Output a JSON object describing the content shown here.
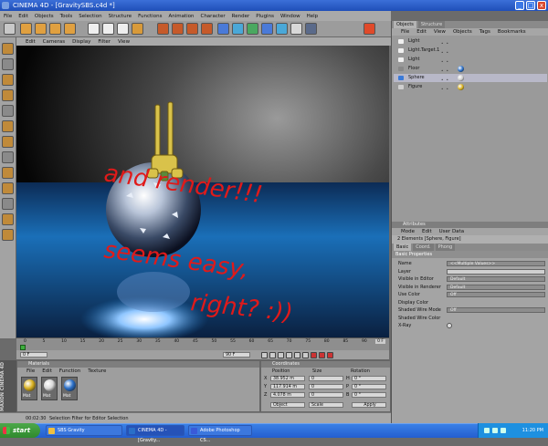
{
  "window": {
    "title": "CINEMA 4D - [GravitySBS.c4d *]",
    "buttons": [
      "_",
      "□",
      "x"
    ]
  },
  "menubar": [
    "File",
    "Edit",
    "Objects",
    "Tools",
    "Selection",
    "Structure",
    "Functions",
    "Animation",
    "Character",
    "Render",
    "Plugins",
    "Window",
    "Help"
  ],
  "viewport_menu": [
    "Edit",
    "Cameras",
    "Display",
    "Filter",
    "View"
  ],
  "annotation": [
    "and render!!!",
    "seems easy,",
    "right? :))"
  ],
  "timeline": {
    "ticks": [
      "0",
      "5",
      "10",
      "15",
      "20",
      "25",
      "30",
      "35",
      "40",
      "45",
      "50",
      "55",
      "60",
      "65",
      "70",
      "75",
      "80",
      "85",
      "90"
    ],
    "end_label": "0 F",
    "start_field": "0 F",
    "end_field": "90 F"
  },
  "materials": {
    "title": "Materials",
    "menu": [
      "File",
      "Edit",
      "Function",
      "Texture"
    ],
    "items": [
      "Mat",
      "Mat",
      "Mat"
    ]
  },
  "coordinates": {
    "title": "Coordinates",
    "headers": [
      "Position",
      "Size",
      "Rotation"
    ],
    "rows": [
      {
        "axis": "X",
        "pos": "38.952 m",
        "size": "0",
        "rot_label": "H",
        "rot": "0 °"
      },
      {
        "axis": "Y",
        "pos": "117.914 m",
        "size": "0",
        "rot_label": "P",
        "rot": "0 °"
      },
      {
        "axis": "Z",
        "pos": "4.078 m",
        "size": "0",
        "rot_label": "B",
        "rot": "0 °"
      }
    ],
    "mode_select": "Object",
    "size_select": "Scale",
    "apply": "Apply"
  },
  "maxon": "MAXON CINEMA 4D",
  "status": {
    "time": "00:02:30",
    "text": "Selection Filter for Editor Selection"
  },
  "object_manager": {
    "tabs": [
      "Objects",
      "Structure"
    ],
    "menu": [
      "File",
      "Edit",
      "View",
      "Objects",
      "Tags",
      "Bookmarks"
    ],
    "objects": [
      "Light",
      "Light.Target.1",
      "Light",
      "Floor",
      "Sphere",
      "Figure"
    ]
  },
  "attributes": {
    "title": "Attributes",
    "menu": [
      "Mode",
      "Edit",
      "User Data"
    ],
    "selection": "2 Elements [Sphere, Figure]",
    "tabs": [
      "Basic",
      "Coord.",
      "Phong"
    ],
    "section": "Basic Properties",
    "rows": [
      {
        "label": "Name",
        "value": "<<Multiple Values>>"
      },
      {
        "label": "Layer",
        "value": ""
      },
      {
        "label": "Visible in Editor",
        "value": "Default"
      },
      {
        "label": "Visible in Renderer",
        "value": "Default"
      },
      {
        "label": "Use Color",
        "value": "Off"
      },
      {
        "label": "Display Color",
        "value": ""
      },
      {
        "label": "Shaded Wire Mode",
        "value": "Off"
      },
      {
        "label": "Shaded Wire Color",
        "value": ""
      },
      {
        "label": "X-Ray",
        "value": ""
      }
    ]
  },
  "taskbar": {
    "start": "start",
    "tasks": [
      "SBS Gravity",
      "CINEMA 4D - [Gravity...",
      "Adobe Photoshop CS..."
    ],
    "clock": "11:20 PM"
  },
  "colors": {
    "annotation": "#e01a1a",
    "accent": "#c08a3a",
    "viewport_floor": "#1a6fb8"
  }
}
